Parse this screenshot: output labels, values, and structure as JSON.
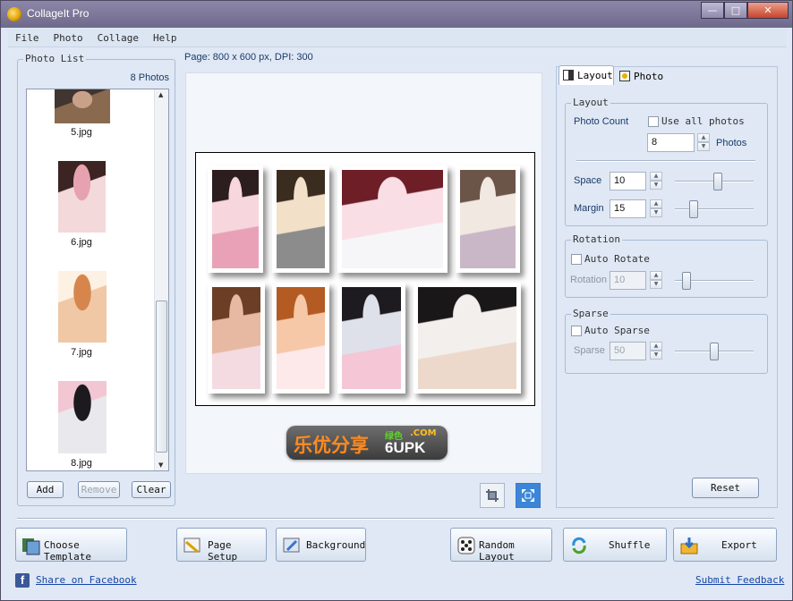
{
  "window": {
    "title": "CollageIt Pro"
  },
  "menu": [
    "File",
    "Photo",
    "Collage",
    "Help"
  ],
  "photo_list": {
    "title": "Photo List",
    "count_text": "8 Photos",
    "items": [
      {
        "label": "5.jpg",
        "colors": [
          "#8a6a4f",
          "#c9a18a",
          "#403530"
        ]
      },
      {
        "label": "6.jpg",
        "colors": [
          "#f3d9da",
          "#e7a2b0",
          "#3b2422"
        ]
      },
      {
        "label": "7.jpg",
        "colors": [
          "#f0c8a6",
          "#d6864d",
          "#fdf1e4"
        ]
      },
      {
        "label": "8.jpg",
        "colors": [
          "#e9e8ec",
          "#1c1a1e",
          "#f2c6d2"
        ]
      }
    ],
    "buttons": {
      "add": "Add",
      "remove": "Remove",
      "clear": "Clear"
    }
  },
  "page_info": "Page: 800 x 600 px, DPI: 300",
  "watermark": {
    "chinese": "乐优分享",
    "domain": "6UPK",
    "tag": "绿色",
    "tld": ".COM"
  },
  "tabs": {
    "layout": "Layout",
    "photo": "Photo"
  },
  "layout_group": {
    "title": "Layout",
    "photo_count_label": "Photo Count",
    "use_all_label": "Use all photos",
    "photo_count_value": "8",
    "photos_unit": "Photos",
    "space_label": "Space",
    "space_value": "10",
    "space_slider": 0.55,
    "margin_label": "Margin",
    "margin_value": "15",
    "margin_slider": 0.2
  },
  "rotation_group": {
    "title": "Rotation",
    "auto_label": "Auto Rotate",
    "rotation_label": "Rotation",
    "rotation_value": "10",
    "rotation_slider": 0.1
  },
  "sparse_group": {
    "title": "Sparse",
    "auto_label": "Auto Sparse",
    "sparse_label": "Sparse",
    "sparse_value": "50",
    "sparse_slider": 0.5
  },
  "reset_label": "Reset",
  "bottom": {
    "choose_template": "Choose Template",
    "page_setup": "Page Setup",
    "background": "Background",
    "random_layout": "Random Layout",
    "shuffle": "Shuffle",
    "export": "Export",
    "share": "Share on Facebook",
    "feedback": "Submit Feedback"
  },
  "collage_colors": [
    [
      "#f7d6de",
      "#2c1d1e",
      "#e9a1b8"
    ],
    [
      "#f3e0c8",
      "#3a2c1f",
      "#8c8c8c"
    ],
    [
      "#f9dfe5",
      "#6d1e26",
      "#f6f6f8"
    ],
    [
      "#f1e8e1",
      "#6b5448",
      "#c9b6c6"
    ],
    [
      "#e7b9a2",
      "#6b3e25",
      "#f4dbe2"
    ],
    [
      "#f6c8a8",
      "#b35b22",
      "#fde8ea"
    ],
    [
      "#dfe1ea",
      "#1d1b20",
      "#f4c6d6"
    ],
    [
      "#f3efed",
      "#1a1718",
      "#ecd9cc"
    ]
  ]
}
